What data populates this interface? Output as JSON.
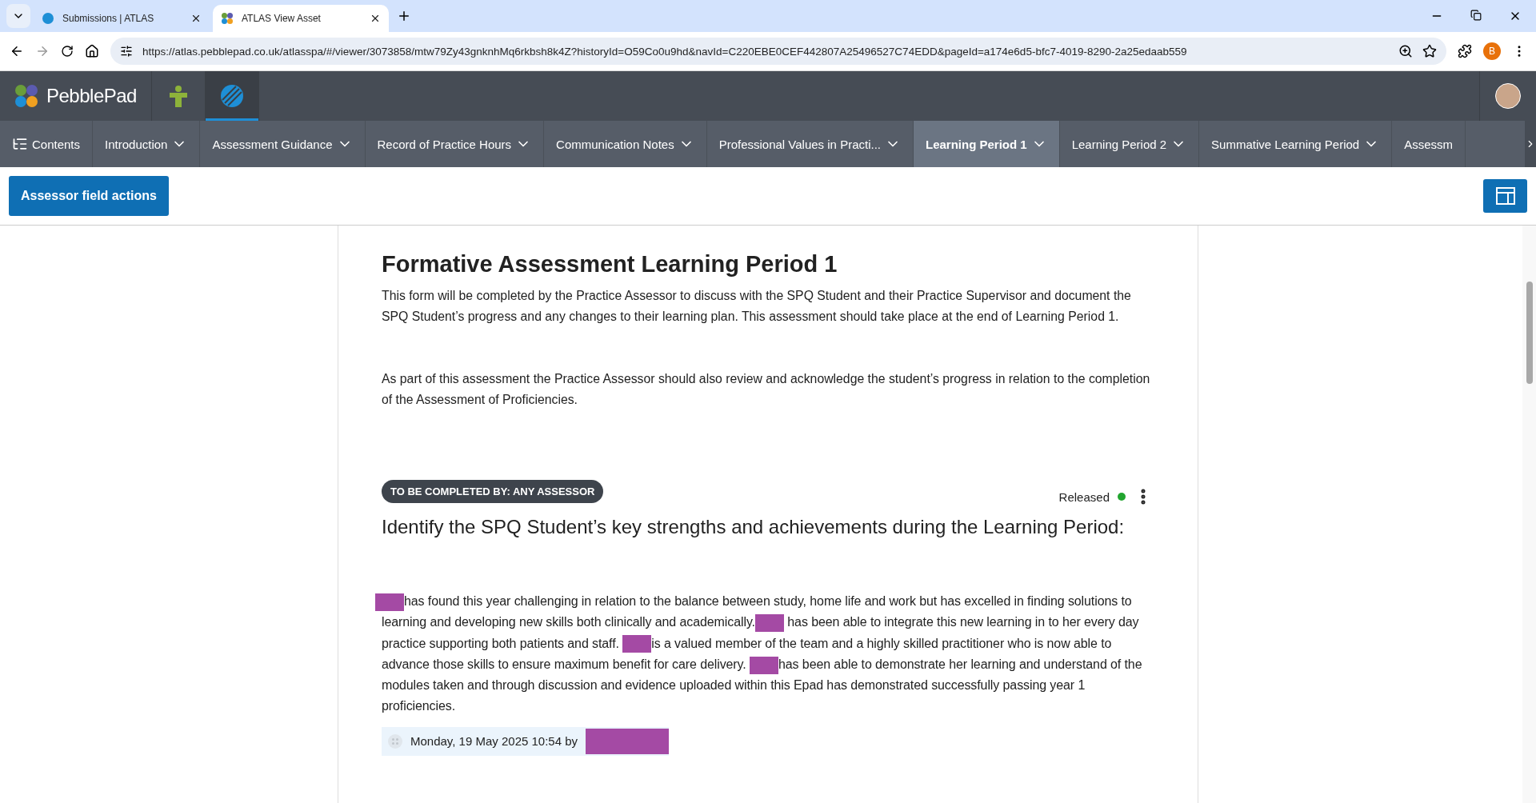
{
  "browser": {
    "tabs": [
      {
        "title": "Submissions | ATLAS",
        "selected": false
      },
      {
        "title": "ATLAS View Asset",
        "selected": true
      }
    ],
    "url": "https://atlas.pebblepad.co.uk/atlasspa/#/viewer/3073858/mtw79Zy43gnknhMq6rkbsh8k4Z?historyId=O59Co0u9hd&navId=C220EBE0CEF442807A25496527C74EDD&pageId=a174e6d5-bfc7-4019-8290-2a25edaab559",
    "profile_initial": "B"
  },
  "app": {
    "brand": "PebblePad"
  },
  "nav": [
    {
      "label": "Contents",
      "kind": "contents",
      "selected": false
    },
    {
      "label": "Introduction",
      "kind": "section",
      "selected": false
    },
    {
      "label": "Assessment Guidance",
      "kind": "section",
      "selected": false
    },
    {
      "label": "Record of Practice Hours",
      "kind": "section",
      "selected": false
    },
    {
      "label": "Communication Notes",
      "kind": "section",
      "selected": false
    },
    {
      "label": "Professional Values in Practi...",
      "kind": "section",
      "selected": false
    },
    {
      "label": "Learning Period 1",
      "kind": "section",
      "selected": true
    },
    {
      "label": "Learning Period 2",
      "kind": "section",
      "selected": false
    },
    {
      "label": "Summative Learning Period",
      "kind": "section",
      "selected": false
    },
    {
      "label": "Assessm",
      "kind": "cut",
      "selected": false
    }
  ],
  "action_button": "Assessor field actions",
  "page": {
    "title": "Formative Assessment Learning Period 1",
    "intro": [
      "This form will be completed by the Practice Assessor to discuss with the SPQ Student and their Practice Supervisor and document the SPQ Student’s progress and any changes to their learning plan. This assessment should take place at the end of Learning Period 1.",
      "As part of this assessment the Practice Assessor should also review and acknowledge the student’s progress in relation to the completion of the Assessment of Proficiencies."
    ],
    "field": {
      "badge": "TO BE COMPLETED BY: ANY ASSESSOR",
      "status": "Released",
      "question": "Identify the SPQ Student’s key strengths and achievements during the Learning Period:",
      "answer": [
        {
          "kind": "redaction"
        },
        {
          "kind": "text",
          "text": "has found this year challenging in relation to the balance between study, home life and work but has excelled in finding solutions to learning and developing new skills both clinically and academically."
        },
        {
          "kind": "redaction"
        },
        {
          "kind": "text",
          "text": " has been able to integrate this new learning in to her every day practice supporting both patients and staff. "
        },
        {
          "kind": "redaction"
        },
        {
          "kind": "text",
          "text": "is a valued member of the team and a highly skilled practitioner who is now able to advance those skills to ensure maximum benefit for care delivery. "
        },
        {
          "kind": "redaction"
        },
        {
          "kind": "text",
          "text": "has been able to demonstrate her learning and understand of the modules taken and through discussion and evidence uploaded within this Epad has demonstrated successfully passing year 1 proficiencies."
        }
      ],
      "timestamp": "Monday, 19 May 2025 10:54 by"
    }
  }
}
